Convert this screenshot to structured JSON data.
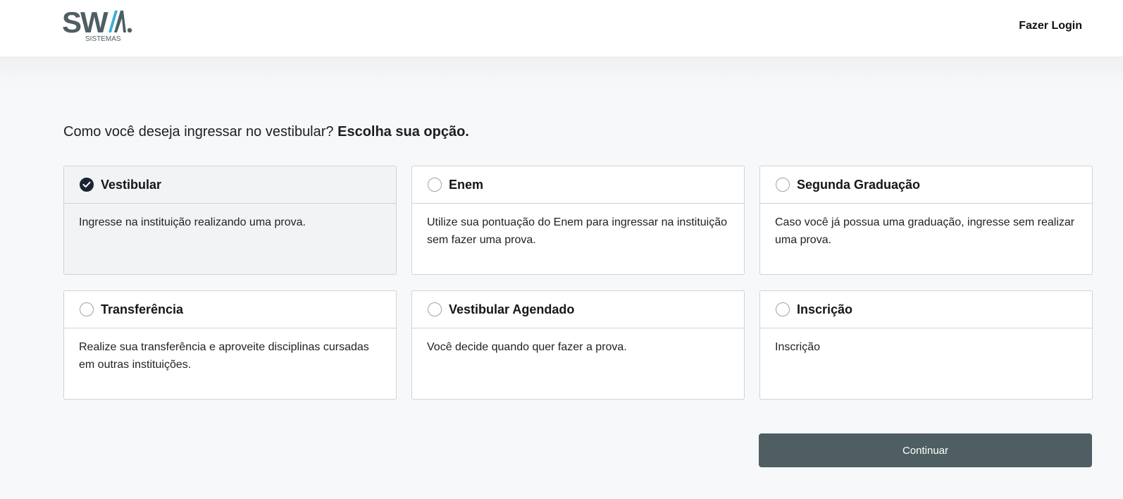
{
  "header": {
    "logo_text": "SWA.",
    "logo_subtext": "SISTEMAS",
    "login_label": "Fazer Login"
  },
  "question": {
    "prefix": "Como você deseja ingressar no vestibular?",
    "emphasis": "Escolha sua opção."
  },
  "options": [
    {
      "title": "Vestibular",
      "description": "Ingresse na instituição realizando uma prova.",
      "selected": true
    },
    {
      "title": "Enem",
      "description": "Utilize sua pontuação do Enem para ingressar na instituição sem fazer uma prova.",
      "selected": false
    },
    {
      "title": "Segunda Graduação",
      "description": "Caso você já possua uma graduação, ingresse sem realizar uma prova.",
      "selected": false
    },
    {
      "title": "Transferência",
      "description": "Realize sua transferência e aproveite disciplinas cursadas em outras instituições.",
      "selected": false
    },
    {
      "title": "Vestibular Agendado",
      "description": "Você decide quando quer fazer a prova.",
      "selected": false
    },
    {
      "title": "Inscrição",
      "description": "Inscrição",
      "selected": false
    }
  ],
  "continue_label": "Continuar",
  "colors": {
    "brand_dark": "#4e5e62",
    "brand_accent": "#3ab0d8",
    "selected_radio": "#1b2430"
  }
}
